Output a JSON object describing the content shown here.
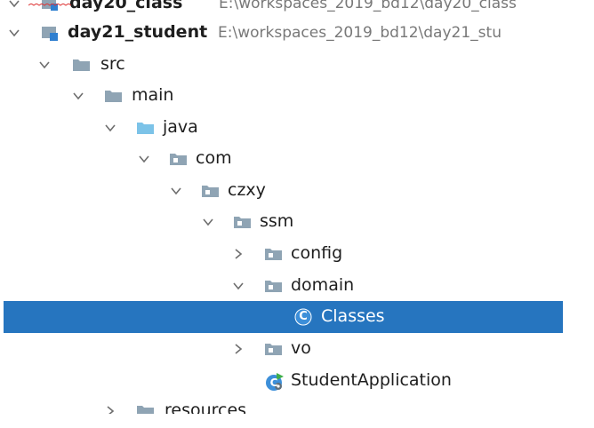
{
  "tree": {
    "top_partial": {
      "name": "day20_class",
      "path": "E:\\workspaces_2019_bd12\\day20_class"
    },
    "project": {
      "name": "day21_student",
      "path": "E:\\workspaces_2019_bd12\\day21_stu"
    },
    "nodes": {
      "src": "src",
      "main": "main",
      "java": "java",
      "com": "com",
      "czxy": "czxy",
      "ssm": "ssm",
      "config": "config",
      "domain": "domain",
      "classes": "Classes",
      "vo": "vo",
      "student_app": "StudentApplication",
      "resources": "resources"
    },
    "icon_letters": {
      "class": "C"
    }
  },
  "colors": {
    "selection": "#2675bf",
    "folder": "#8fa4b4",
    "source_folder": "#7cc3e8",
    "class_icon": "#3d8fd9",
    "path_text": "#787878",
    "chevron": "#6e6e6e"
  }
}
